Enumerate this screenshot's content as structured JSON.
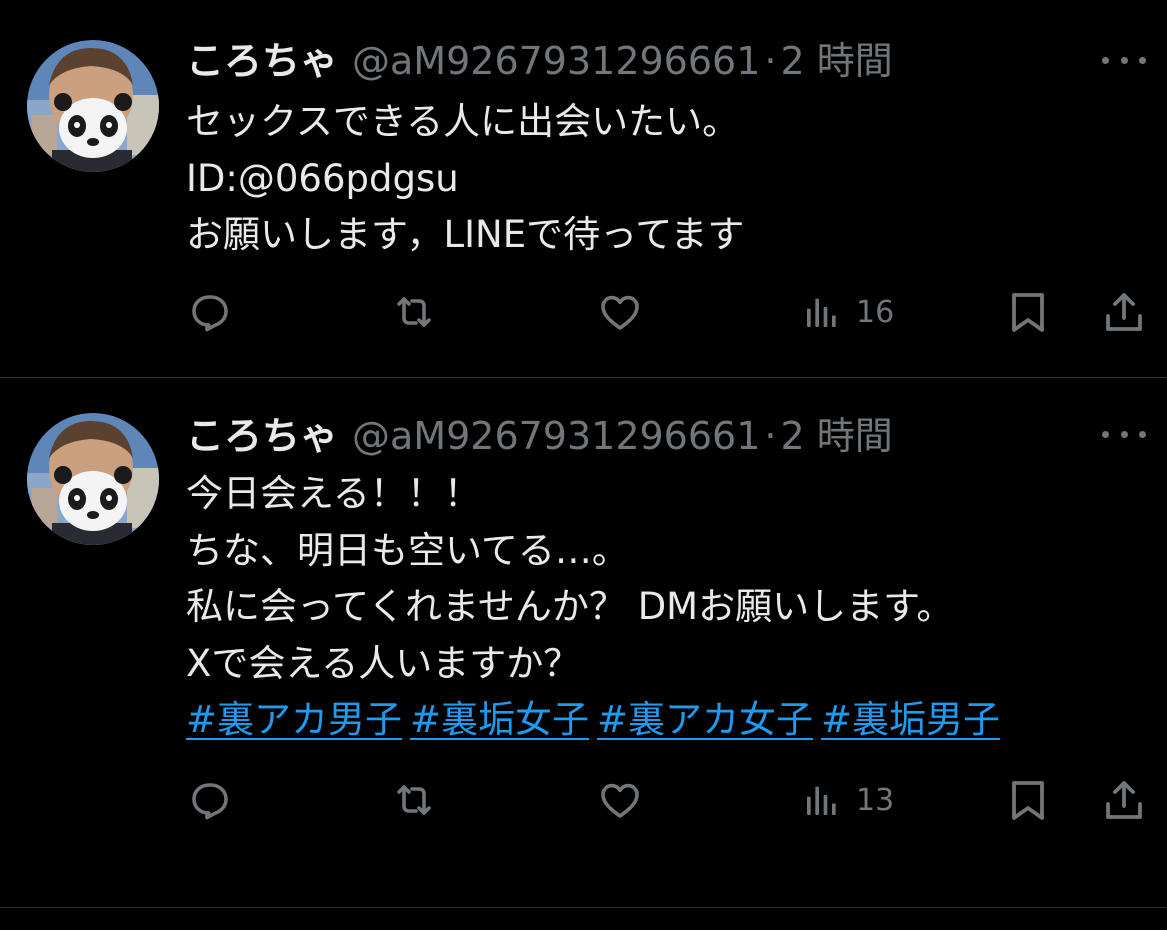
{
  "colors": {
    "background": "#000000",
    "text": "#e7e9ea",
    "secondary": "#71767b",
    "link": "#1d9bf0",
    "divider": "#2f3336"
  },
  "tweets": [
    {
      "display_name": "ころちゃ",
      "handle": "@aM9267931296661",
      "separator": "·",
      "time": "2 時間",
      "lines": [
        "セックスできる人に出会いたい。",
        "ID:@066pdgsu",
        "お願いします，LINEで待ってます"
      ],
      "hashtags": [],
      "views": "16",
      "icons": {
        "more": "more-icon",
        "reply": "reply-icon",
        "retweet": "retweet-icon",
        "like": "heart-icon",
        "views": "views-icon",
        "bookmark": "bookmark-icon",
        "share": "share-icon"
      }
    },
    {
      "display_name": "ころちゃ",
      "handle": "@aM9267931296661",
      "separator": "·",
      "time": "2 時間",
      "lines": [
        "今日会える！！！",
        "ちな、明日も空いてる…。",
        "私に会ってくれませんか？ DMお願いします。",
        "Xで会える人いますか？"
      ],
      "hashtags": [
        "#裏アカ男子",
        "#裏垢女子",
        "#裏アカ女子",
        "#裏垢男子"
      ],
      "views": "13",
      "icons": {
        "more": "more-icon",
        "reply": "reply-icon",
        "retweet": "retweet-icon",
        "like": "heart-icon",
        "views": "views-icon",
        "bookmark": "bookmark-icon",
        "share": "share-icon"
      }
    }
  ]
}
